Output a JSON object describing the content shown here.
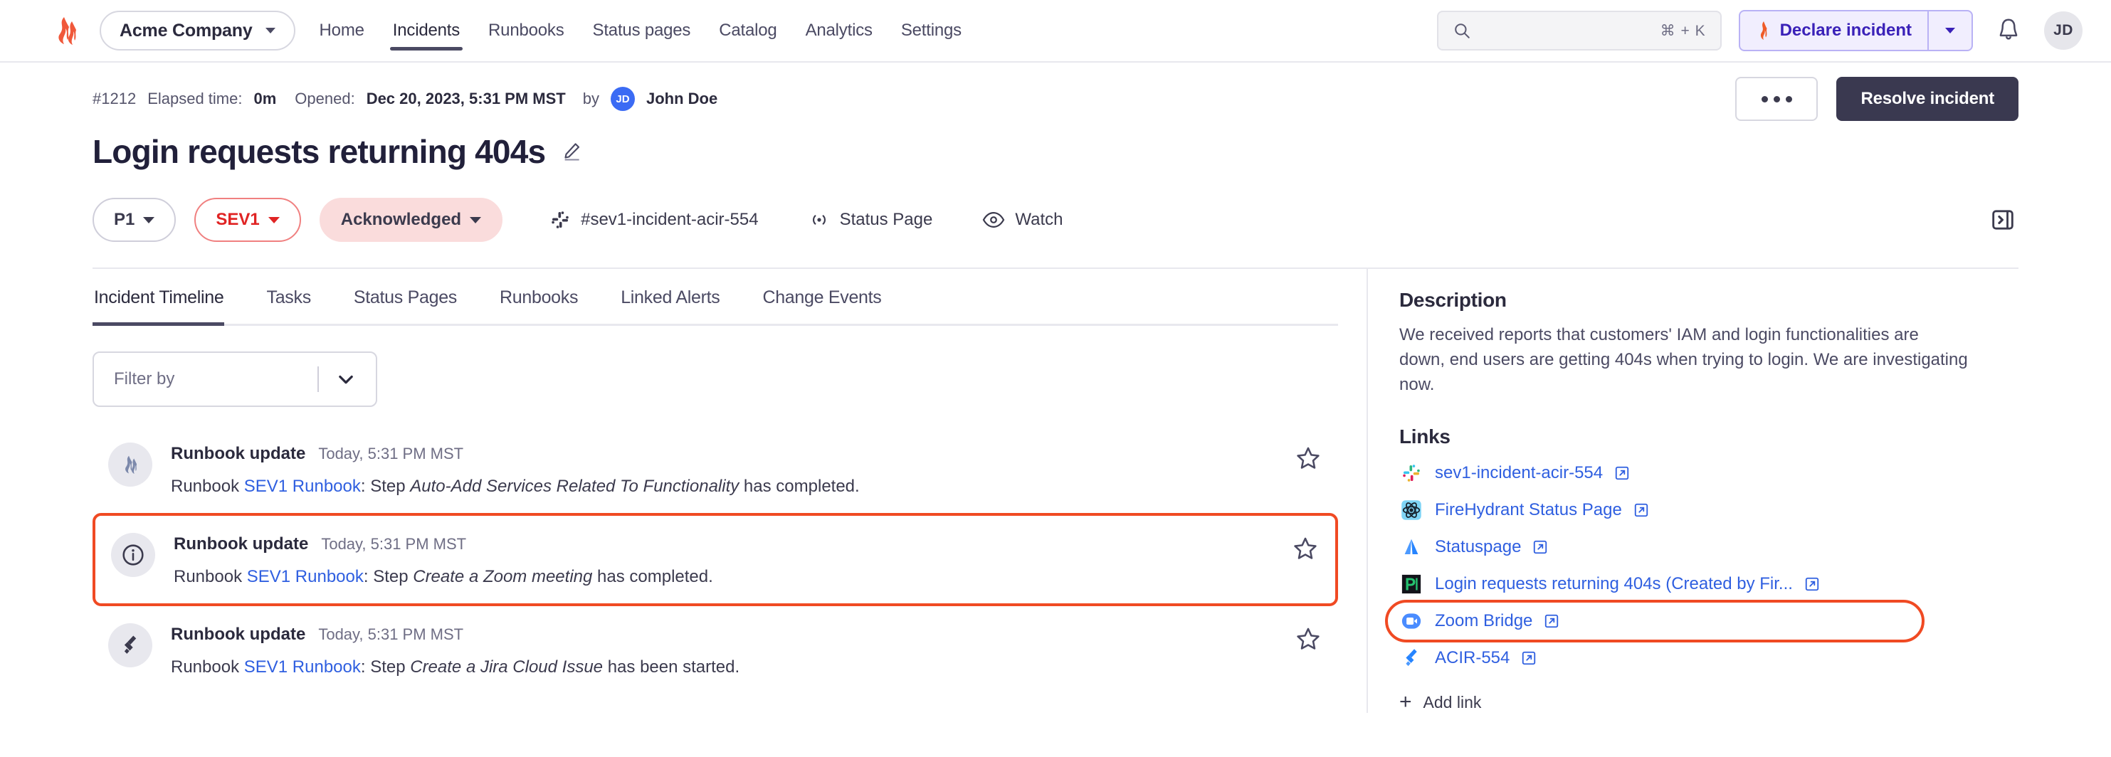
{
  "nav": {
    "logo": "firehydrant-logo",
    "org": {
      "name": "Acme Company",
      "caret": "chevron-down-icon"
    },
    "links": [
      {
        "label": "Home",
        "active": false
      },
      {
        "label": "Incidents",
        "active": true
      },
      {
        "label": "Runbooks",
        "active": false
      },
      {
        "label": "Status pages",
        "active": false
      },
      {
        "label": "Catalog",
        "active": false
      },
      {
        "label": "Analytics",
        "active": false
      },
      {
        "label": "Settings",
        "active": false
      }
    ],
    "search": {
      "placeholder": "",
      "shortcut": "⌘ + K",
      "icon": "search-icon"
    },
    "declare": {
      "label": "Declare incident",
      "icon": "flame-icon",
      "caret": "chevron-down-icon",
      "accent": "#3A21B8",
      "bg": "#F1EEFE",
      "border": "#B9B2F5"
    },
    "bell": "bell-icon",
    "avatar": "JD"
  },
  "meta": {
    "id": "#1212",
    "elapsed_label": "Elapsed time:",
    "elapsed_value": "0m",
    "opened_label": "Opened:",
    "opened_value": "Dec 20, 2023, 5:31 PM MST",
    "by_label": "by",
    "author_initials": "JD",
    "author_name": "John Doe",
    "more_button": "…",
    "resolve_button": "Resolve incident"
  },
  "incident": {
    "title": "Login requests returning 404s",
    "edit_icon": "pencil-icon",
    "priority": "P1",
    "severity": "SEV1",
    "status": "Acknowledged",
    "slack_channel": "#sev1-incident-acir-554",
    "status_page": "Status Page",
    "watch": "Watch",
    "collapse_icon": "panel-collapse-icon"
  },
  "tabs": [
    {
      "label": "Incident Timeline",
      "active": true
    },
    {
      "label": "Tasks",
      "active": false
    },
    {
      "label": "Status Pages",
      "active": false
    },
    {
      "label": "Runbooks",
      "active": false
    },
    {
      "label": "Linked Alerts",
      "active": false
    },
    {
      "label": "Change Events",
      "active": false
    }
  ],
  "filter": {
    "placeholder": "Filter by",
    "caret": "chevron-down-icon"
  },
  "timeline": [
    {
      "icon": "firehydrant-icon",
      "title": "Runbook update",
      "time": "Today, 5:31 PM MST",
      "prefix": "Runbook ",
      "link": "SEV1 Runbook",
      "mid": ": Step ",
      "emphasis": "Auto-Add Services Related To Functionality",
      "suffix": " has completed.",
      "star": "star-outline-icon",
      "highlighted": false
    },
    {
      "icon": "info-circle-icon",
      "title": "Runbook update",
      "time": "Today, 5:31 PM MST",
      "prefix": "Runbook ",
      "link": "SEV1 Runbook",
      "mid": ": Step ",
      "emphasis": "Create a Zoom meeting",
      "suffix": " has completed.",
      "star": "star-outline-icon",
      "highlighted": true
    },
    {
      "icon": "jira-icon",
      "title": "Runbook update",
      "time": "Today, 5:31 PM MST",
      "prefix": "Runbook ",
      "link": "SEV1 Runbook",
      "mid": ": Step ",
      "emphasis": "Create a Jira Cloud Issue",
      "suffix": " has been started.",
      "star": "star-outline-icon",
      "highlighted": false
    }
  ],
  "sidebar": {
    "description_heading": "Description",
    "description_body": "We received reports that customers' IAM and login functionalities are down, end users are getting 404s when trying to login. We are investigating now.",
    "links_heading": "Links",
    "links": [
      {
        "icon": "slack-icon",
        "label": "sev1-incident-acir-554",
        "ringed": false
      },
      {
        "icon": "firehydrant-status-icon",
        "label": "FireHydrant Status Page",
        "ringed": false
      },
      {
        "icon": "statuspage-icon",
        "label": "Statuspage",
        "ringed": false
      },
      {
        "icon": "pagerduty-icon",
        "label": "Login requests returning 404s (Created by Fir...",
        "ringed": false
      },
      {
        "icon": "zoom-icon",
        "label": "Zoom Bridge",
        "ringed": true
      },
      {
        "icon": "jira-icon",
        "label": "ACIR-554",
        "ringed": false
      }
    ],
    "add_link": "Add link"
  },
  "colors": {
    "accent_red": "#F04A23",
    "link_blue": "#2F5FE0",
    "sev_red": "#E02424",
    "ack_bg": "#FADCDC",
    "dark": "#3A3950"
  }
}
